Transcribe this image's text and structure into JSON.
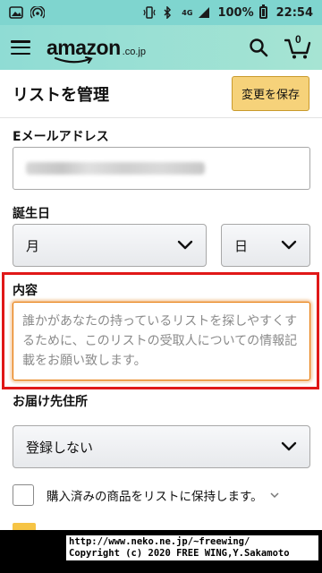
{
  "status_bar": {
    "signal_label": "4G",
    "battery": "100%",
    "time": "22:54"
  },
  "header": {
    "logo_text": "amazon",
    "logo_suffix": ".co.jp",
    "cart_count": "0"
  },
  "page": {
    "title": "リストを管理",
    "save_label": "変更を保存"
  },
  "form": {
    "email_label": "Eメールアドレス",
    "birthday_label": "誕生日",
    "month_value": "月",
    "day_value": "日",
    "content_label": "内容",
    "content_placeholder": "誰かがあなたの持っているリストを探しやすくするために、このリストの受取人についての情報記載をお願い致します。",
    "address_label": "お届け先住所",
    "address_value": "登録しない",
    "keep_purchased_label": "購入済みの商品をリストに保持します。"
  },
  "watermark": {
    "line1": "http://www.neko.ne.jp/~freewing/",
    "line2": "Copyright (c) 2020 FREE WING,Y.Sakamoto"
  },
  "colors": {
    "header_start": "#8fdcd4",
    "header_end": "#a6e4d3",
    "save_button": "#f6d27a",
    "focus_outline": "#e77600",
    "highlight_red": "#e01818"
  }
}
